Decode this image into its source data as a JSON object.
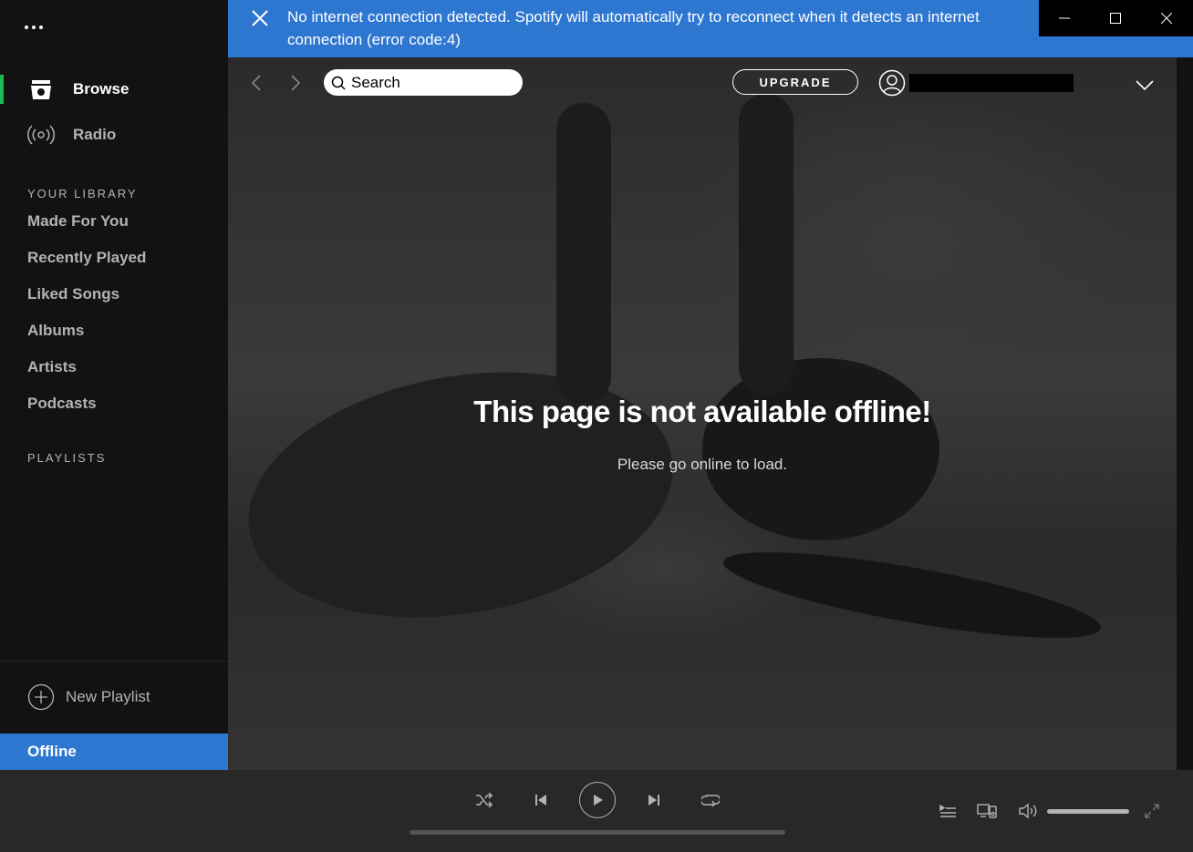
{
  "window": {
    "controls": [
      "minimize",
      "maximize",
      "close"
    ]
  },
  "banner": {
    "message": "No internet connection detected. Spotify will automatically try to reconnect when it detects an internet connection (error code:4)"
  },
  "sidebar": {
    "nav": [
      {
        "label": "Browse",
        "icon": "browse-icon",
        "active": true
      },
      {
        "label": "Radio",
        "icon": "radio-icon",
        "active": false
      }
    ],
    "library_title": "YOUR LIBRARY",
    "library": [
      "Made For You",
      "Recently Played",
      "Liked Songs",
      "Albums",
      "Artists",
      "Podcasts"
    ],
    "playlists_title": "PLAYLISTS",
    "new_playlist": "New Playlist",
    "offline_label": "Offline"
  },
  "topbar": {
    "search_placeholder": "Search",
    "upgrade_label": "UPGRADE"
  },
  "main": {
    "title": "This page is not available offline!",
    "subtitle": "Please go online to load."
  },
  "player": {
    "progress": 0,
    "volume": 1.0
  },
  "colors": {
    "accent_green": "#1db954",
    "banner_blue": "#2e77d0",
    "sidebar_bg": "#121212",
    "player_bg": "#282828"
  }
}
